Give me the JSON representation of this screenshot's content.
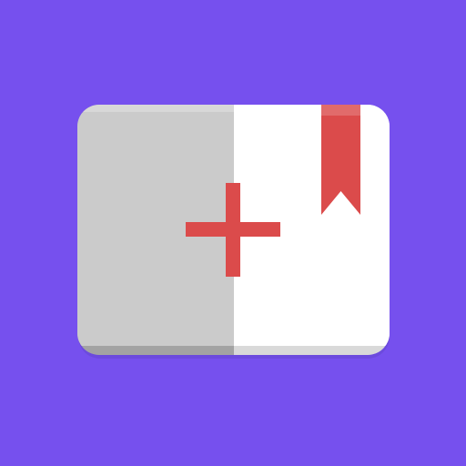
{
  "app_icon": {
    "name": "add-bookmark-app-icon",
    "colors": {
      "background": "#7650ee",
      "left_panel": "#cbcbcb",
      "right_panel": "#ffffff",
      "bottom_edge_left": "#a3a3a3",
      "bottom_edge_right": "#d9d9d9",
      "shadow": "#5b3fbf",
      "accent": "#db4b4b"
    },
    "glyphs": [
      "plus-icon",
      "bookmark-icon"
    ]
  }
}
